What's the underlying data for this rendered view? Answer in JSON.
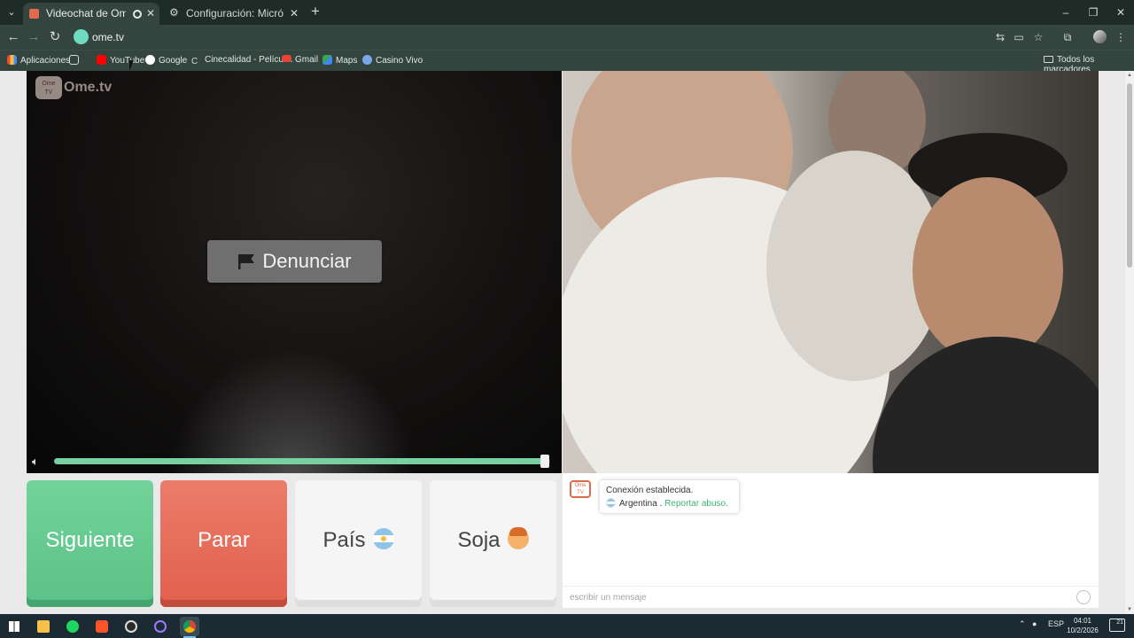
{
  "browser": {
    "tabs": [
      {
        "title": "Videochat de OmeTV: una",
        "active": true,
        "recording": true
      },
      {
        "title": "Configuración: Micrófono",
        "active": false
      }
    ],
    "url": "ome.tv",
    "bookmarks": [
      {
        "label": "Aplicaciones",
        "icon": "apps-grid-icon"
      },
      {
        "label": "YouTube",
        "icon": "youtube-icon",
        "color": "#ff0000"
      },
      {
        "label": "Google",
        "icon": "google-icon",
        "color": "#ffffff"
      },
      {
        "label": "Cinecalidad - Películ...",
        "icon": "cinecalidad-icon",
        "color": "#34443e"
      },
      {
        "label": "Gmail",
        "icon": "gmail-icon",
        "color": "#ea4335"
      },
      {
        "label": "Maps",
        "icon": "maps-icon",
        "color": "#34a853"
      },
      {
        "label": "Casino Vivo",
        "icon": "globe-icon",
        "color": "#7aa7e8"
      }
    ],
    "bookmarks_folder": "Todos los marcadores"
  },
  "page": {
    "logo_text": "Ome.tv",
    "report_label": "Denunciar",
    "volume_level": 0.99,
    "controls": {
      "next": "Siguiente",
      "stop": "Parar",
      "country": "País",
      "gender": "Soja"
    },
    "chat": {
      "status": "Conexión establecida.",
      "country": "Argentina",
      "separator": ".",
      "report_link": "Reportar abuso.",
      "input_placeholder": "escribir un mensaje"
    }
  },
  "taskbar": {
    "language": "ESP",
    "time": "04:01",
    "date": "10/2/2026",
    "notifications": "21"
  },
  "colors": {
    "next": "#5bc186",
    "stop": "#e0604d",
    "accent_link": "#3db37a",
    "chrome_dark": "#1f2b27",
    "chrome_toolbar": "#34443e"
  }
}
